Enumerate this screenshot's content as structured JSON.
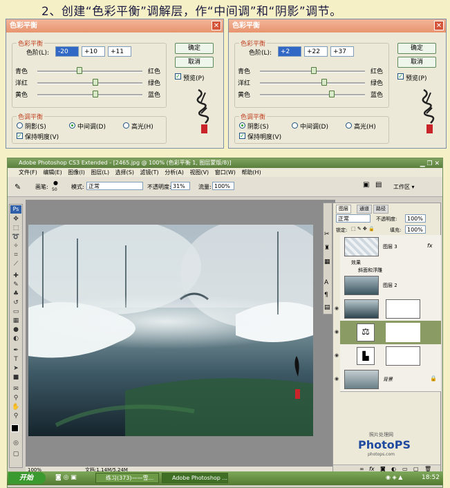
{
  "heading": "2、创建“色彩平衡”调解层，作“中间调”和“阴影”调节。",
  "dialogs": [
    {
      "title": "色彩平衡",
      "group_balance": "色彩平衡",
      "levels_label": "色阶(L):",
      "levels": [
        "-20",
        "+10",
        "+11"
      ],
      "slider_left": [
        "青色",
        "洋红",
        "黄色"
      ],
      "slider_right": [
        "红色",
        "绿色",
        "蓝色"
      ],
      "slider_values": [
        -20,
        10,
        11
      ],
      "ok": "确定",
      "cancel": "取消",
      "preview": "预览(P)",
      "group_tone": "色调平衡",
      "tones": [
        "阴影(S)",
        "中间调(D)",
        "高光(H)"
      ],
      "tone_selected": 1,
      "preserve": "保持明度(V)"
    },
    {
      "title": "色彩平衡",
      "group_balance": "色彩平衡",
      "levels_label": "色阶(L):",
      "levels": [
        "+2",
        "+22",
        "+37"
      ],
      "slider_left": [
        "青色",
        "洋红",
        "黄色"
      ],
      "slider_right": [
        "红色",
        "绿色",
        "蓝色"
      ],
      "slider_values": [
        2,
        22,
        37
      ],
      "ok": "确定",
      "cancel": "取消",
      "preview": "预览(P)",
      "group_tone": "色调平衡",
      "tones": [
        "阴影(S)",
        "中间调(D)",
        "高光(H)"
      ],
      "tone_selected": 0,
      "preserve": "保持明度(V)"
    }
  ],
  "ps": {
    "title": "Adobe Photoshop CS3 Extended - [2465.jpg @ 100% (色彩平衡 1, 图层蒙版/8)]",
    "menu": [
      "文件(F)",
      "编辑(E)",
      "图像(I)",
      "图层(L)",
      "选择(S)",
      "滤镜(T)",
      "分析(A)",
      "视图(V)",
      "窗口(W)",
      "帮助(H)"
    ],
    "brush_label": "画笔:",
    "brush_size": "50",
    "mode_label": "模式:",
    "mode": "正常",
    "opacity_label": "不透明度:",
    "opacity": "31%",
    "flow_label": "流量:",
    "flow": "100%",
    "workspace": "工作区 ▾",
    "zoom": "100%",
    "doc_size": "文档:1.14M/5.24M",
    "ps_badge": "Ps"
  },
  "layers_panel": {
    "tabs": [
      "图层",
      "通道",
      "路径"
    ],
    "blend": "正常",
    "opacity_label": "不透明度:",
    "opacity": "100%",
    "lock_label": "锁定:",
    "fill_label": "填充:",
    "fill": "100%",
    "layers": [
      {
        "name": "图层 3",
        "fx": "fx"
      },
      {
        "name": "效果"
      },
      {
        "name": "斜面和浮雕"
      },
      {
        "name": "图层 2"
      },
      {
        "name": ""
      },
      {
        "name": ""
      },
      {
        "name": ""
      },
      {
        "name": "背景"
      }
    ],
    "watermark_top": "照片处理网",
    "watermark_brand": "PhotoPS",
    "watermark_url": "photops.com"
  },
  "taskbar": {
    "start": "开始",
    "items": [
      "练习(373)——雪...",
      "Adobe Photoshop ..."
    ],
    "clock": "18:52"
  }
}
